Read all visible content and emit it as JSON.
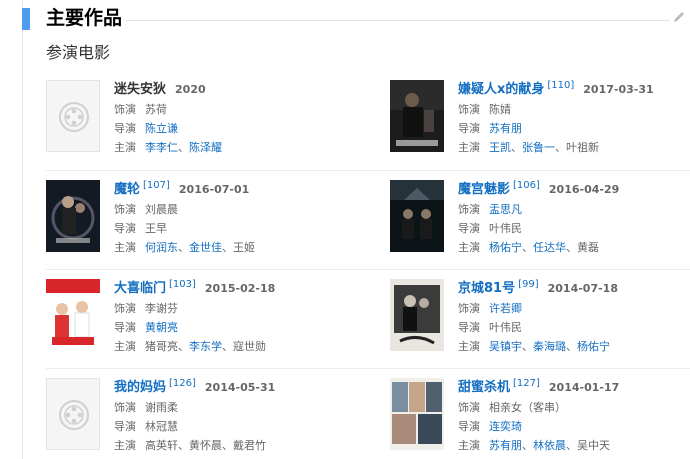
{
  "section_title": "主要作品",
  "subtitle": "参演电影",
  "labels": {
    "role": "饰演",
    "director": "导演",
    "cast": "主演"
  },
  "films": [
    {
      "title": "迷失安狄",
      "title_link": false,
      "ref": "",
      "date": "2020",
      "poster": "placeholder",
      "role": "苏荷",
      "director": [
        {
          "name": "陈立谦",
          "link": true
        }
      ],
      "cast": [
        {
          "name": "李李仁",
          "link": true
        },
        {
          "name": "、",
          "link": false
        },
        {
          "name": "陈泽耀",
          "link": true
        }
      ]
    },
    {
      "title": "嫌疑人x的献身",
      "title_link": true,
      "ref": "[110]",
      "date": "2017-03-31",
      "poster": "dark-man",
      "role": "陈婧",
      "director": [
        {
          "name": "苏有朋",
          "link": true
        }
      ],
      "cast": [
        {
          "name": "王凯",
          "link": true
        },
        {
          "name": "、",
          "link": false
        },
        {
          "name": "张鲁一",
          "link": true
        },
        {
          "name": "、叶祖新",
          "link": false
        }
      ]
    },
    {
      "title": "魔轮",
      "title_link": true,
      "ref": "[107]",
      "date": "2016-07-01",
      "poster": "dark-wheel",
      "role": "刘晨晨",
      "director": [
        {
          "name": "王早",
          "link": false
        }
      ],
      "cast": [
        {
          "name": "何润东",
          "link": true
        },
        {
          "name": "、",
          "link": false
        },
        {
          "name": "金世佳",
          "link": true
        },
        {
          "name": "、王姬",
          "link": false
        }
      ]
    },
    {
      "title": "魔宫魅影",
      "title_link": true,
      "ref": "[106]",
      "date": "2016-04-29",
      "poster": "dark-palace",
      "role": "盂思凡",
      "role_link": true,
      "director": [
        {
          "name": "叶伟民",
          "link": false
        }
      ],
      "cast": [
        {
          "name": "杨佑宁",
          "link": true
        },
        {
          "name": "、",
          "link": false
        },
        {
          "name": "任达华",
          "link": true
        },
        {
          "name": "、黄磊",
          "link": false
        }
      ]
    },
    {
      "title": "大喜临门",
      "title_link": true,
      "ref": "[103]",
      "date": "2015-02-18",
      "poster": "red-wedding",
      "role": "李谢芬",
      "director": [
        {
          "name": "黄朝亮",
          "link": true
        }
      ],
      "cast": [
        {
          "name": "猪哥亮",
          "link": false
        },
        {
          "name": "、",
          "link": false
        },
        {
          "name": "李东学",
          "link": true
        },
        {
          "name": "、寇世勋",
          "link": false
        }
      ]
    },
    {
      "title": "京城81号",
      "title_link": true,
      "ref": "[99]",
      "date": "2014-07-18",
      "poster": "bw-house",
      "role": "许若卿",
      "role_link": true,
      "director": [
        {
          "name": "叶伟民",
          "link": false
        }
      ],
      "cast": [
        {
          "name": "吴镇宇",
          "link": true
        },
        {
          "name": "、",
          "link": false
        },
        {
          "name": "秦海璐",
          "link": true
        },
        {
          "name": "、",
          "link": false
        },
        {
          "name": "杨佑宁",
          "link": true
        }
      ]
    },
    {
      "title": "我的妈妈",
      "title_link": true,
      "ref": "[126]",
      "date": "2014-05-31",
      "poster": "placeholder",
      "role": "谢雨柔",
      "director": [
        {
          "name": "林冠慧",
          "link": false
        }
      ],
      "cast": [
        {
          "name": "高英轩、黄怀晨、戴君竹",
          "link": false
        }
      ]
    },
    {
      "title": "甜蜜杀机",
      "title_link": true,
      "ref": "[127]",
      "date": "2014-01-17",
      "poster": "multi-faces",
      "role": "相亲女（客串）",
      "director": [
        {
          "name": "连奕琦",
          "link": true
        }
      ],
      "cast": [
        {
          "name": "苏有朋",
          "link": true
        },
        {
          "name": "、",
          "link": false
        },
        {
          "name": "林依晨",
          "link": true
        },
        {
          "name": "、吴中天",
          "link": false
        }
      ]
    }
  ]
}
